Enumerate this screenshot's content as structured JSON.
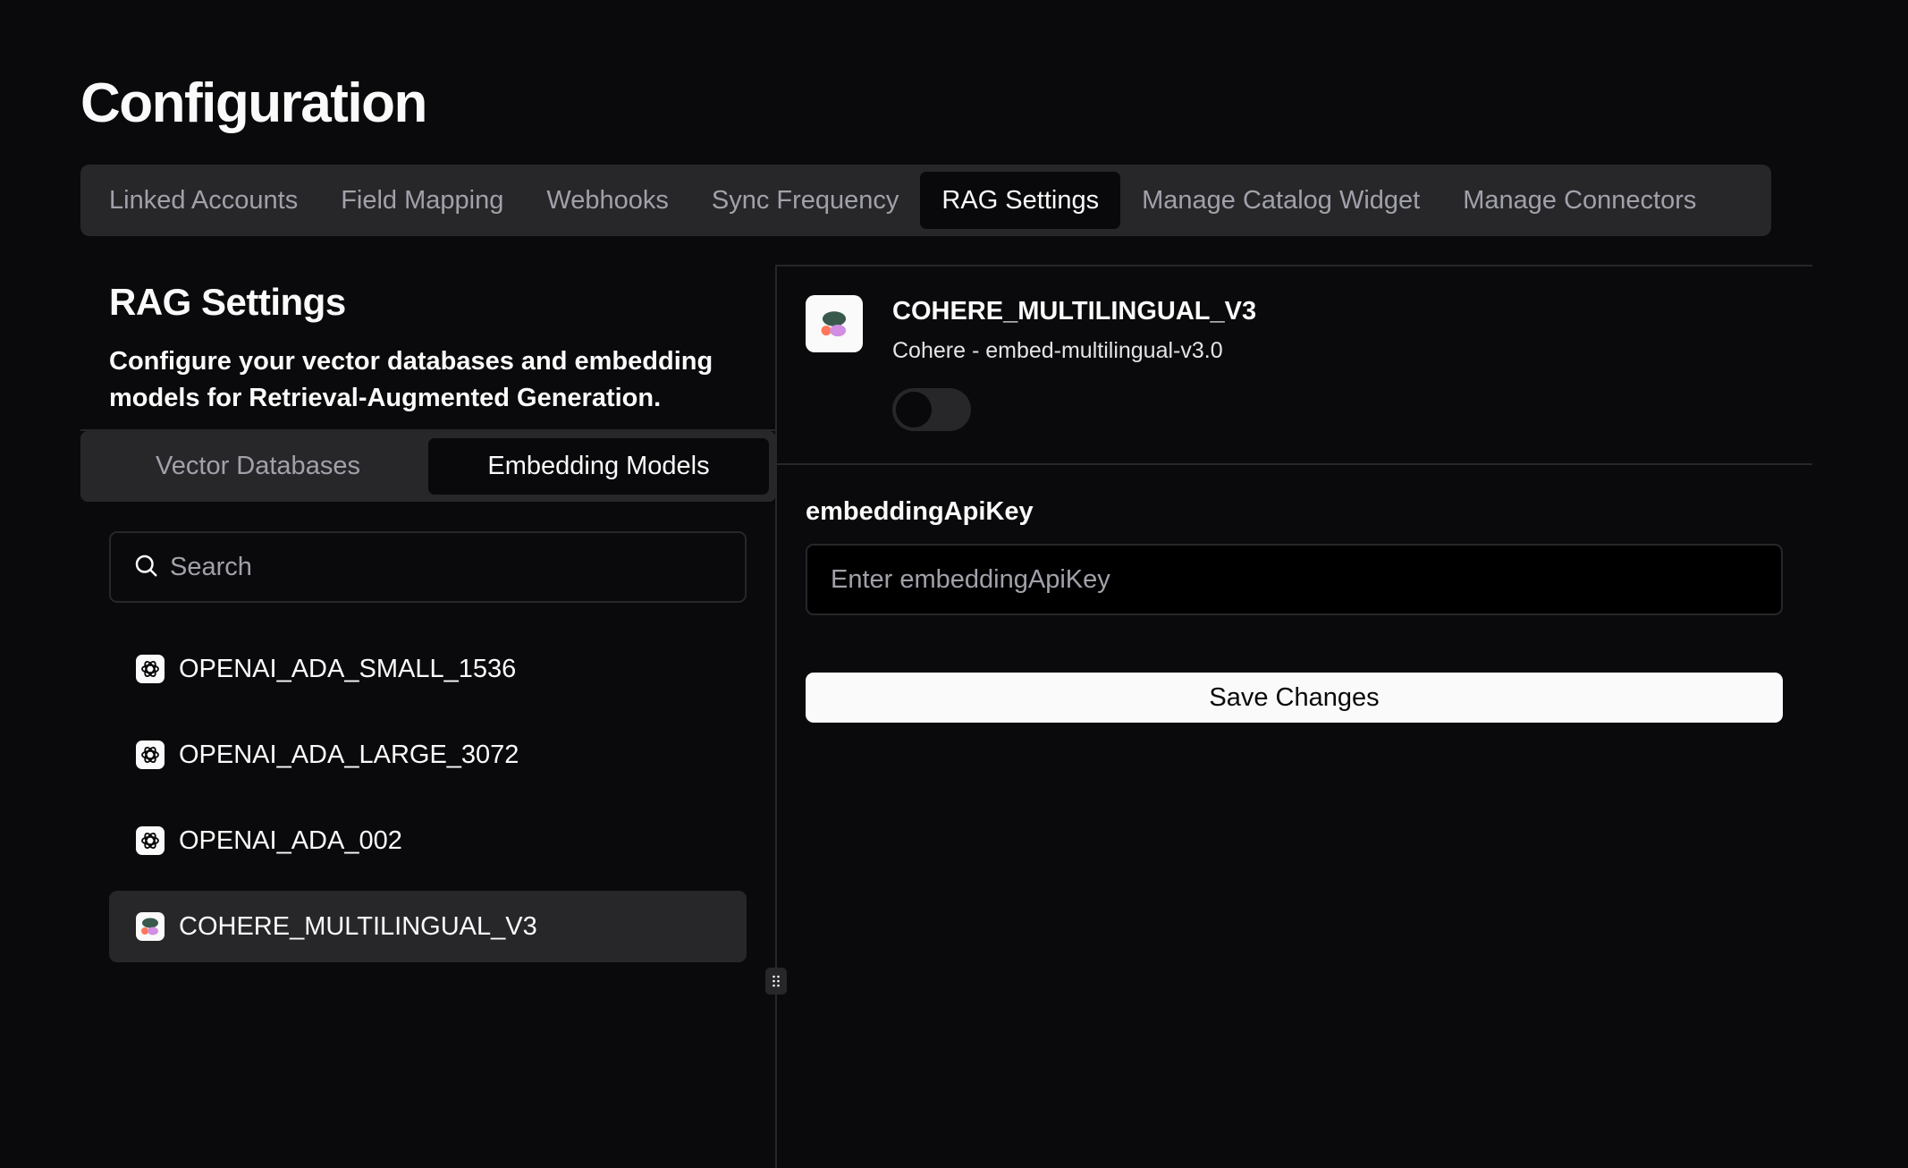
{
  "page": {
    "title": "Configuration"
  },
  "tabs": [
    {
      "label": "Linked Accounts"
    },
    {
      "label": "Field Mapping"
    },
    {
      "label": "Webhooks"
    },
    {
      "label": "Sync Frequency"
    },
    {
      "label": "RAG Settings",
      "active": true
    },
    {
      "label": "Manage Catalog Widget"
    },
    {
      "label": "Manage Connectors"
    }
  ],
  "rag": {
    "title": "RAG Settings",
    "description": "Configure your vector databases and embedding models for Retrieval-Augmented Generation.",
    "segments": [
      {
        "label": "Vector Databases"
      },
      {
        "label": "Embedding Models",
        "active": true
      }
    ],
    "search": {
      "placeholder": "Search",
      "icon": "search-icon"
    },
    "models": [
      {
        "name": "OPENAI_ADA_SMALL_1536",
        "icon": "openai-logo-icon"
      },
      {
        "name": "OPENAI_ADA_LARGE_3072",
        "icon": "openai-logo-icon"
      },
      {
        "name": "OPENAI_ADA_002",
        "icon": "openai-logo-icon"
      },
      {
        "name": "COHERE_MULTILINGUAL_V3",
        "icon": "cohere-logo-icon",
        "selected": true
      }
    ]
  },
  "detail": {
    "name": "COHERE_MULTILINGUAL_V3",
    "subtitle": "Cohere - embed-multilingual-v3.0",
    "enabled": false,
    "field_label": "embeddingApiKey",
    "field_placeholder": "Enter embeddingApiKey",
    "field_value": "",
    "save_label": "Save Changes"
  },
  "colors": {
    "background": "#0a0a0c",
    "surface": "#27272a",
    "active": "#09090b",
    "text": "#fafafa",
    "muted": "#a1a1aa"
  }
}
